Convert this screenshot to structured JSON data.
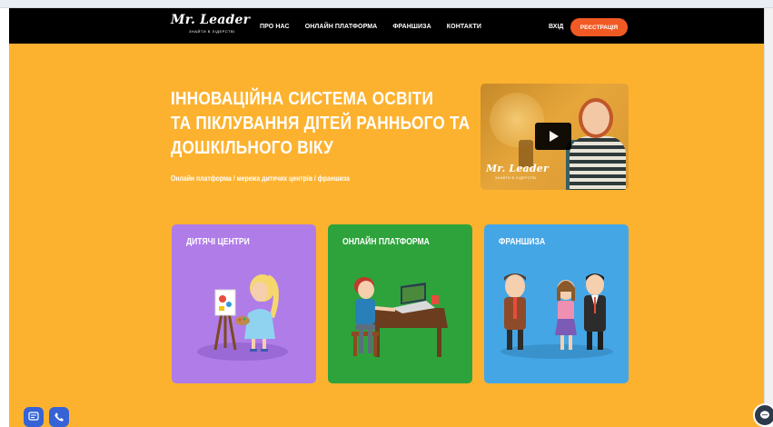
{
  "header": {
    "logo": {
      "main": "Mr. Leader",
      "sub": "ЗНАЙТИ В ЛІДЕРСТВІ"
    },
    "nav": [
      "ПРО НАС",
      "ОНЛАЙН ПЛАТФОРМА",
      "ФРАНШИЗА",
      "КОНТАКТИ"
    ],
    "login": "ВХІД",
    "register": "РЕЄСТРАЦІЯ"
  },
  "hero": {
    "title_lines": [
      "ІННОВАЦІЙНА СИСТЕМА ОСВІТИ",
      "ТА ПІКЛУВАННЯ ДІТЕЙ РАННЬОГО ТА",
      "ДОШКІЛЬНОГО ВІКУ"
    ],
    "subtitle": "Онлайн платформа / мережа дитячих центрів / франшиза",
    "video": {
      "logo_main": "Mr. Leader",
      "logo_sub": "ЗНАЙТИ В ЛІДЕРСТВІ"
    }
  },
  "cards": [
    {
      "title": "ДИТЯЧІ ЦЕНТРИ",
      "color": "#b07ce8"
    },
    {
      "title": "ОНЛАЙН ПЛАТФОРМА",
      "color": "#2ea33b"
    },
    {
      "title": "ФРАНШИЗА",
      "color": "#45a6e6"
    }
  ],
  "colors": {
    "page_background": "#fdb22f",
    "header_background": "#000000",
    "accent": "#f15a24"
  },
  "floating": {
    "left_buttons": [
      "chat-icon",
      "phone-icon"
    ],
    "right_button": "messenger-icon"
  }
}
